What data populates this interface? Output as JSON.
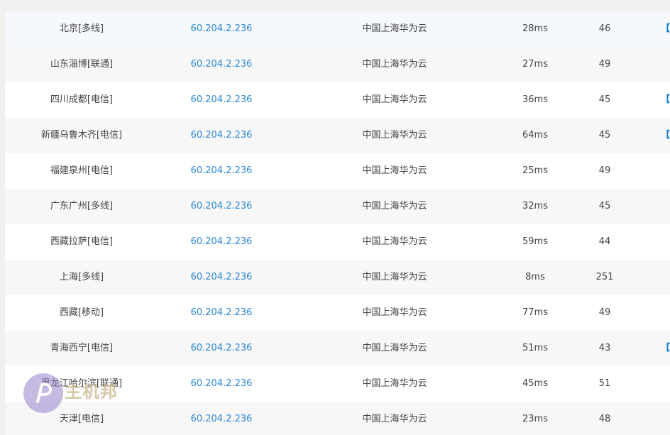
{
  "rows": [
    {
      "node": "北京[多线]",
      "ip": "60.204.2.236",
      "location": "中国上海华为云",
      "latency": "28ms",
      "ttl": "46",
      "action": "【",
      "style": "odd"
    },
    {
      "node": "山东淄博[联通]",
      "ip": "60.204.2.236",
      "location": "中国上海华为云",
      "latency": "27ms",
      "ttl": "49",
      "action": "",
      "style": "gray"
    },
    {
      "node": "四川成都[电信]",
      "ip": "60.204.2.236",
      "location": "中国上海华为云",
      "latency": "36ms",
      "ttl": "45",
      "action": "【复",
      "style": "even"
    },
    {
      "node": "新疆乌鲁木齐[电信]",
      "ip": "60.204.2.236",
      "location": "中国上海华为云",
      "latency": "64ms",
      "ttl": "45",
      "action": "【",
      "style": "gray"
    },
    {
      "node": "福建泉州[电信]",
      "ip": "60.204.2.236",
      "location": "中国上海华为云",
      "latency": "25ms",
      "ttl": "49",
      "action": "",
      "style": "even"
    },
    {
      "node": "广东广州[多线]",
      "ip": "60.204.2.236",
      "location": "中国上海华为云",
      "latency": "32ms",
      "ttl": "45",
      "action": "",
      "style": "gray"
    },
    {
      "node": "西藏拉萨[电信]",
      "ip": "60.204.2.236",
      "location": "中国上海华为云",
      "latency": "59ms",
      "ttl": "44",
      "action": "",
      "style": "even"
    },
    {
      "node": "上海[多线]",
      "ip": "60.204.2.236",
      "location": "中国上海华为云",
      "latency": "8ms",
      "ttl": "251",
      "action": "",
      "style": "gray"
    },
    {
      "node": "西藏[移动]",
      "ip": "60.204.2.236",
      "location": "中国上海华为云",
      "latency": "77ms",
      "ttl": "49",
      "action": "",
      "style": "even"
    },
    {
      "node": "青海西宁[电信]",
      "ip": "60.204.2.236",
      "location": "中国上海华为云",
      "latency": "51ms",
      "ttl": "43",
      "action": "【",
      "style": "gray"
    },
    {
      "node": "黑龙江哈尔滨[联通]",
      "ip": "60.204.2.236",
      "location": "中国上海华为云",
      "latency": "45ms",
      "ttl": "51",
      "action": "",
      "style": "even"
    },
    {
      "node": "天津[电信]",
      "ip": "60.204.2.236",
      "location": "中国上海华为云",
      "latency": "23ms",
      "ttl": "48",
      "action": "",
      "style": "gray"
    }
  ],
  "watermark": {
    "text": "主机邦",
    "icon": "watermark-logo-icon"
  },
  "colors": {
    "link": "#2a87d8",
    "action": "#1a7fd6",
    "text": "#444444",
    "background": "#f0f0f0"
  }
}
